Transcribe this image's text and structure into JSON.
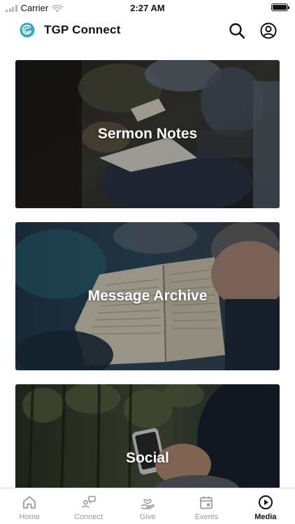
{
  "status_bar": {
    "carrier": "Carrier",
    "time": "2:27 AM"
  },
  "header": {
    "title": "TGP Connect",
    "logo_icon": "tgp-logo-icon",
    "search_icon": "search-icon",
    "account_icon": "account-icon"
  },
  "cards": [
    {
      "label": "Sermon Notes",
      "image": "people-with-notebooks-photo"
    },
    {
      "label": "Message Archive",
      "image": "open-bible-photo"
    },
    {
      "label": "Social",
      "image": "phone-in-hand-photo"
    }
  ],
  "tab_bar": {
    "tabs": [
      {
        "label": "Home",
        "icon": "home-icon",
        "active": false
      },
      {
        "label": "Connect",
        "icon": "connect-icon",
        "active": false
      },
      {
        "label": "Give",
        "icon": "give-icon",
        "active": false
      },
      {
        "label": "Events",
        "icon": "calendar-icon",
        "active": false
      },
      {
        "label": "Media",
        "icon": "play-circle-icon",
        "active": true
      }
    ]
  },
  "colors": {
    "logo": "#3aa7b8",
    "active_tab": "#111111",
    "inactive_tab": "#9a9a9a"
  }
}
